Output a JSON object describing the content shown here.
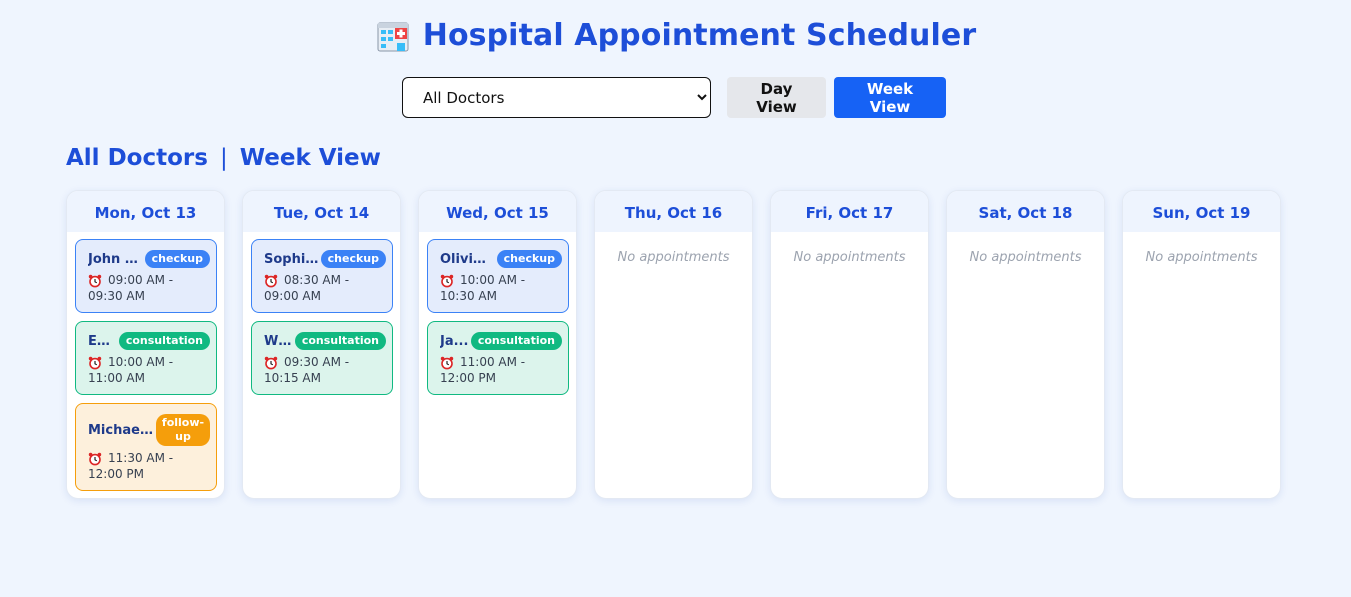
{
  "app": {
    "title": "Hospital Appointment Scheduler"
  },
  "controls": {
    "doctor_select": {
      "selected": "All Doctors",
      "options": [
        "All Doctors"
      ]
    },
    "day_view_label": "Day View",
    "week_view_label": "Week View"
  },
  "heading": {
    "doctor": "All Doctors",
    "separator": "|",
    "view": "Week View"
  },
  "colors": {
    "accent": "#1d4ed8",
    "checkup": "#3b82f6",
    "consultation": "#10b981",
    "follow_up": "#f59e0b"
  },
  "days": [
    {
      "label": "Mon, Oct 13",
      "appointments": [
        {
          "patient": "John S...",
          "type": "checkup",
          "time": "09:00 AM - 09:30 AM"
        },
        {
          "patient": "Em...",
          "type": "consultation",
          "time": "10:00 AM - 11:00 AM"
        },
        {
          "patient": "Michael...",
          "type": "follow-up",
          "time": "11:30 AM - 12:00 PM"
        }
      ]
    },
    {
      "label": "Tue, Oct 14",
      "appointments": [
        {
          "patient": "Sophi...",
          "type": "checkup",
          "time": "08:30 AM - 09:00 AM"
        },
        {
          "patient": "Wil...",
          "type": "consultation",
          "time": "09:30 AM - 10:15 AM"
        }
      ]
    },
    {
      "label": "Wed, Oct 15",
      "appointments": [
        {
          "patient": "Olivia ...",
          "type": "checkup",
          "time": "10:00 AM - 10:30 AM"
        },
        {
          "patient": "Ja...",
          "type": "consultation",
          "time": "11:00 AM - 12:00 PM"
        }
      ]
    },
    {
      "label": "Thu, Oct 16",
      "appointments": []
    },
    {
      "label": "Fri, Oct 17",
      "appointments": []
    },
    {
      "label": "Sat, Oct 18",
      "appointments": []
    },
    {
      "label": "Sun, Oct 19",
      "appointments": []
    }
  ],
  "empty_text": "No appointments",
  "icons": {
    "title_icon": "hospital-icon",
    "time_icon": "alarm-clock-icon"
  }
}
